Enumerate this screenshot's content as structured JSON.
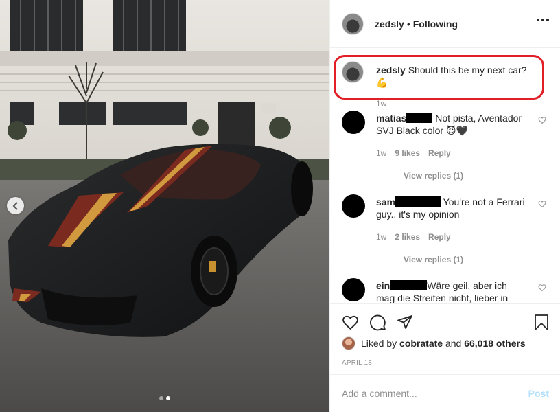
{
  "post": {
    "username": "zedsly",
    "separator": "•",
    "follow_status": "Following",
    "caption_user": "zedsly",
    "caption_text": "Should this be my next car?",
    "caption_emoji": "💪",
    "caption_time": "1w"
  },
  "comments": [
    {
      "user": "matias",
      "text": "Not pista, Aventador SVJ Black color",
      "emoji": "😈🖤",
      "time": "1w",
      "likes": "9 likes",
      "reply": "Reply",
      "view_replies": "View replies (1)"
    },
    {
      "user": "sam",
      "text": "You're not a Ferrari guy.. it's my opinion",
      "time": "1w",
      "likes": "2 likes",
      "reply": "Reply",
      "view_replies": "View replies (1)"
    },
    {
      "user": "ein",
      "text": "Wäre geil, aber ich mag die Streifen nicht, lieber in"
    }
  ],
  "liked_by": {
    "prefix": "Liked by",
    "user": "cobratate",
    "middle": "and",
    "count": "66,018 others"
  },
  "date": "APRIL 18",
  "add_comment": {
    "placeholder": "Add a comment...",
    "post_label": "Post"
  },
  "icons": [
    "heart-icon",
    "comment-icon",
    "share-icon",
    "bookmark-icon",
    "more-icon",
    "chevron-left-icon"
  ],
  "carousel": {
    "total": 2,
    "active": 2
  },
  "colors": {
    "highlight": "#e21e27",
    "text": "#262626",
    "muted": "#8e8e8e",
    "post_disabled": "#b2dffc"
  }
}
